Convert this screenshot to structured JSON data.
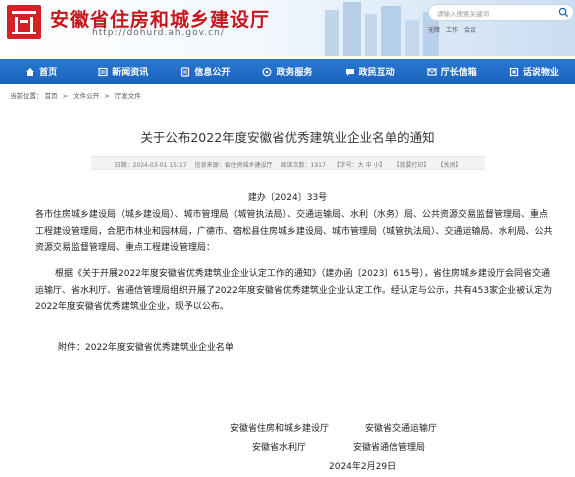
{
  "header": {
    "site_title": "安徽省住房和城乡建设厅",
    "site_url": "http://dohurd.ah.gov.cn/",
    "search_placeholder": "请输入搜索关键词",
    "top_links": [
      "无障",
      "工作",
      "会议"
    ],
    "brand_color": "#c4161c"
  },
  "nav": {
    "color": "#1a63bd",
    "items": [
      {
        "label": "首页",
        "icon": "home-icon"
      },
      {
        "label": "新闻资讯",
        "icon": "news-icon"
      },
      {
        "label": "信息公开",
        "icon": "info-icon"
      },
      {
        "label": "政务服务",
        "icon": "service-icon"
      },
      {
        "label": "政民互动",
        "icon": "interaction-icon"
      },
      {
        "label": "厅长信箱",
        "icon": "mail-icon"
      },
      {
        "label": "话说物业",
        "icon": "property-icon"
      }
    ]
  },
  "breadcrumb": {
    "prefix": "当前位置：",
    "items": [
      "首页",
      "文件公开",
      "厅发文件"
    ]
  },
  "article": {
    "title": "关于公布2022年度安徽省优秀建筑业企业名单的通知",
    "meta": {
      "date": "日期：2024-03-01 15:17",
      "source": "信息来源：省住房城乡建设厅",
      "views": "阅读次数：1917",
      "font_size": "【字号：大 中 小】",
      "comment": "【我要打印】",
      "close": "【关闭】"
    },
    "doc_number": "建办〔2024〕33号",
    "recipients": "各市住房城乡建设局（城乡建设局）、城市管理局（城管执法局）、交通运输局、水利（水务）局、公共资源交易监督管理局、重点工程建设管理局，合肥市林业和园林局，广德市、宿松县住房城乡建设局、城市管理局（城管执法局）、交通运输局、水利局、公共资源交易监督管理局、重点工程建设管理局：",
    "body": "根据《关于开展2022年度安徽省优秀建筑业企业认定工作的通知》（建办函〔2023〕615号），省住房城乡建设厅会同省交通运输厅、省水利厅、省通信管理局组织开展了2022年度安徽省优秀建筑业企业认定工作。经认定与公示，共有453家企业被认定为2022年度安徽省优秀建筑业企业，现予以公布。",
    "attachment": "附件：2022年度安徽省优秀建筑业企业名单",
    "signatures": {
      "line1_left": "安徽省住房和城乡建设厅",
      "line1_right": "安徽省交通运输厅",
      "line2_left": "安徽省水利厅",
      "line2_right": "安徽省通信管理局",
      "date": "2024年2月29日"
    }
  }
}
